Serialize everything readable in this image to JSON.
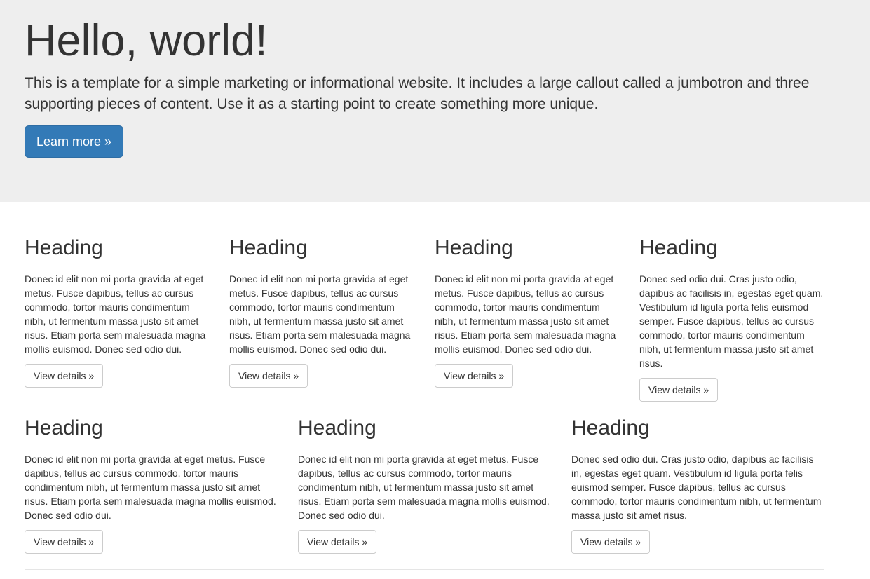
{
  "jumbotron": {
    "title": "Hello, world!",
    "text": "This is a template for a simple marketing or informational website. It includes a large callout called a jumbotron and three supporting pieces of content. Use it as a starting point to create something more unique.",
    "button_label": "Learn more »"
  },
  "row1": [
    {
      "heading": "Heading",
      "text": "Donec id elit non mi porta gravida at eget metus. Fusce dapibus, tellus ac cursus commodo, tortor mauris condimentum nibh, ut fermentum massa justo sit amet risus. Etiam porta sem malesuada magna mollis euismod. Donec sed odio dui.",
      "button_label": "View details »"
    },
    {
      "heading": "Heading",
      "text": "Donec id elit non mi porta gravida at eget metus. Fusce dapibus, tellus ac cursus commodo, tortor mauris condimentum nibh, ut fermentum massa justo sit amet risus. Etiam porta sem malesuada magna mollis euismod. Donec sed odio dui.",
      "button_label": "View details »"
    },
    {
      "heading": "Heading",
      "text": "Donec id elit non mi porta gravida at eget metus. Fusce dapibus, tellus ac cursus commodo, tortor mauris condimentum nibh, ut fermentum massa justo sit amet risus. Etiam porta sem malesuada magna mollis euismod. Donec sed odio dui.",
      "button_label": "View details »"
    },
    {
      "heading": "Heading",
      "text": "Donec sed odio dui. Cras justo odio, dapibus ac facilisis in, egestas eget quam. Vestibulum id ligula porta felis euismod semper. Fusce dapibus, tellus ac cursus commodo, tortor mauris condimentum nibh, ut fermentum massa justo sit amet risus.",
      "button_label": "View details »"
    }
  ],
  "row2": [
    {
      "heading": "Heading",
      "text": "Donec id elit non mi porta gravida at eget metus. Fusce dapibus, tellus ac cursus commodo, tortor mauris condimentum nibh, ut fermentum massa justo sit amet risus. Etiam porta sem malesuada magna mollis euismod. Donec sed odio dui.",
      "button_label": "View details »"
    },
    {
      "heading": "Heading",
      "text": "Donec id elit non mi porta gravida at eget metus. Fusce dapibus, tellus ac cursus commodo, tortor mauris condimentum nibh, ut fermentum massa justo sit amet risus. Etiam porta sem malesuada magna mollis euismod. Donec sed odio dui.",
      "button_label": "View details »"
    },
    {
      "heading": "Heading",
      "text": "Donec sed odio dui. Cras justo odio, dapibus ac facilisis in, egestas eget quam. Vestibulum id ligula porta felis euismod semper. Fusce dapibus, tellus ac cursus commodo, tortor mauris condimentum nibh, ut fermentum massa justo sit amet risus.",
      "button_label": "View details »"
    }
  ],
  "colors": {
    "jumbotron_bg": "#eeeeee",
    "primary": "#337ab7",
    "text": "#333333"
  }
}
